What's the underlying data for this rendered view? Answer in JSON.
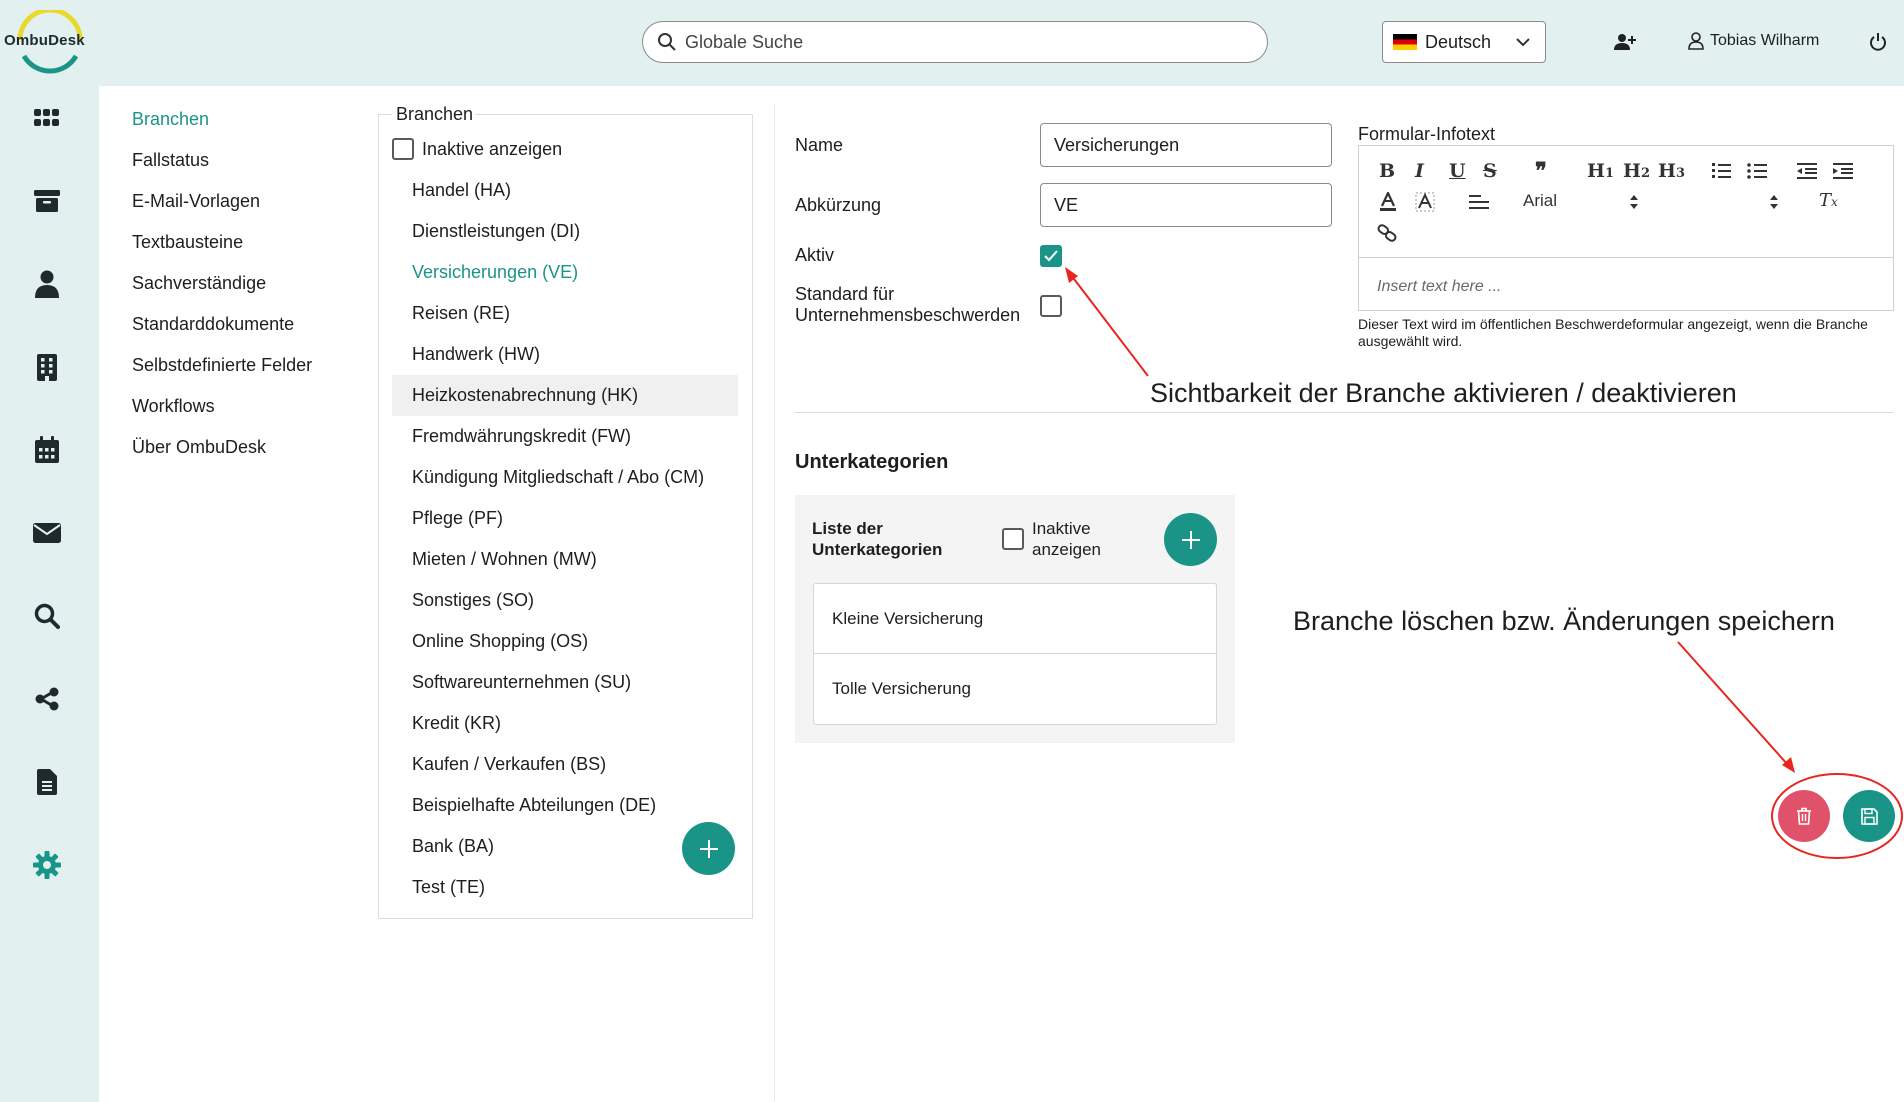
{
  "app": {
    "logo_text": "OmbuDesk"
  },
  "header": {
    "search_placeholder": "Globale Suche",
    "language": "Deutsch",
    "user_name": "Tobias Wilharm"
  },
  "rail": {
    "icons": [
      "dashboard-grid-icon",
      "archive-icon",
      "person-icon",
      "building-icon",
      "calendar-icon",
      "mail-icon",
      "search-icon",
      "share-icon",
      "document-icon",
      "gear-icon"
    ]
  },
  "settings_nav": {
    "items": [
      "Branchen",
      "Fallstatus",
      "E-Mail-Vorlagen",
      "Textbausteine",
      "Sachverständige",
      "Standarddokumente",
      "Selbstdefinierte Felder",
      "Workflows",
      "Über OmbuDesk"
    ],
    "active": "Branchen"
  },
  "branches": {
    "title": "Branchen",
    "inactive_label": "Inaktive anzeigen",
    "items": [
      "Handel (HA)",
      "Dienstleistungen (DI)",
      "Versicherungen (VE)",
      "Reisen (RE)",
      "Handwerk (HW)",
      "Heizkostenabrechnung (HK)",
      "Fremdwährungskredit (FW)",
      "Kündigung Mitgliedschaft / Abo (CM)",
      "Pflege (PF)",
      "Mieten / Wohnen (MW)",
      "Sonstiges (SO)",
      "Online Shopping (OS)",
      "Softwareunternehmen (SU)",
      "Kredit (KR)",
      "Kaufen / Verkaufen (BS)",
      "Beispielhafte Abteilungen (DE)",
      "Bank (BA)",
      "Test (TE)"
    ],
    "selected": "Versicherungen (VE)",
    "hovered": "Heizkostenabrechnung (HK)"
  },
  "detail": {
    "name_label": "Name",
    "name_value": "Versicherungen",
    "abbr_label": "Abkürzung",
    "abbr_value": "VE",
    "active_label": "Aktiv",
    "active_checked": true,
    "standard_label_1": "Standard für",
    "standard_label_2": "Unternehmensbeschwerden",
    "standard_checked": false,
    "infotext_label": "Formular-Infotext",
    "editor_font": "Arial",
    "editor_placeholder": "Insert text here ...",
    "help_text": "Dieser Text wird im öffentlichen Beschwerdeformular angezeigt, wenn die Branche ausgewählt wird.",
    "toolbar": {
      "bold": "B",
      "italic": "I",
      "underline": "U",
      "strike": "S",
      "quote": "❞",
      "h1": "H",
      "h1_sub": "1",
      "h2": "H",
      "h2_sub": "2",
      "h3": "H",
      "h3_sub": "3"
    }
  },
  "subcategories": {
    "title": "Unterkategorien",
    "list_title_1": "Liste der",
    "list_title_2": "Unterkategorien",
    "inactive_1": "Inaktive",
    "inactive_2": "anzeigen",
    "items": [
      "Kleine Versicherung",
      "Tolle Versicherung"
    ]
  },
  "annotations": {
    "visibility": "Sichtbarkeit der Branche aktivieren / deaktivieren",
    "delete_save": "Branche löschen bzw. Änderungen speichern"
  },
  "colors": {
    "accent": "#1b9488",
    "danger": "#e05269",
    "rail_bg": "#e2f1f0",
    "annotation": "#e8251f"
  }
}
